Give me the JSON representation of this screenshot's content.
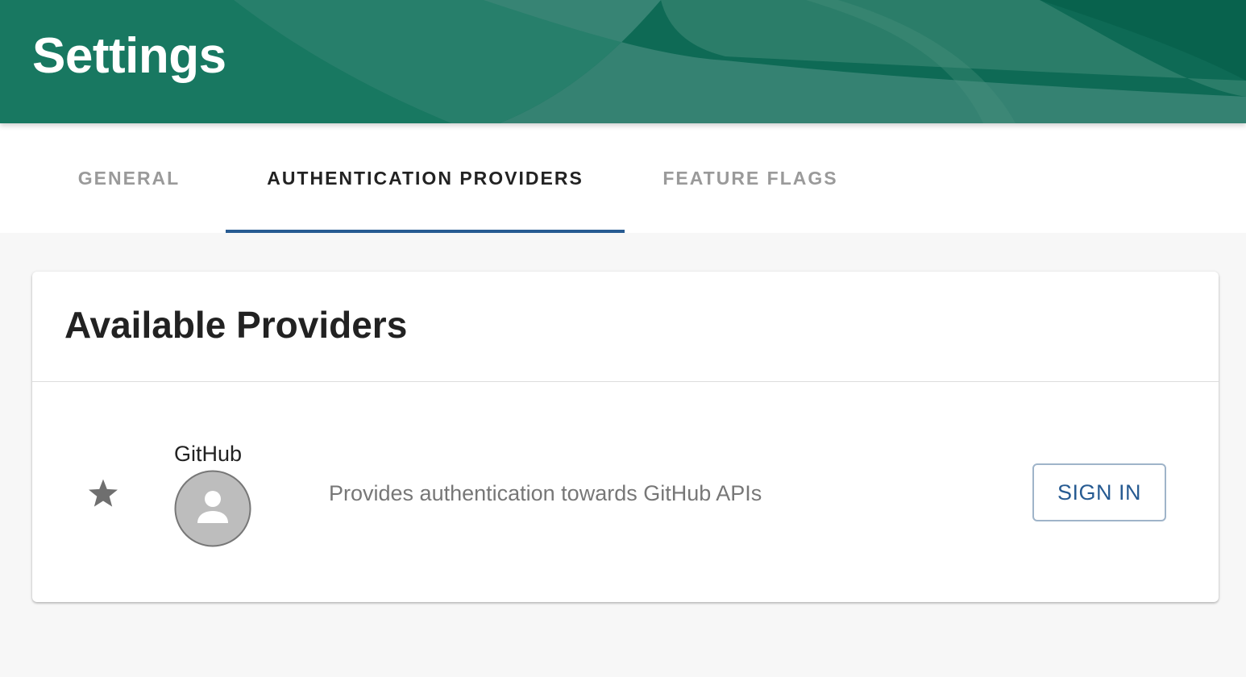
{
  "header": {
    "title": "Settings",
    "background_color": "#0e6a55"
  },
  "tabs": [
    {
      "label": "GENERAL",
      "active": false
    },
    {
      "label": "AUTHENTICATION PROVIDERS",
      "active": true
    },
    {
      "label": "FEATURE FLAGS",
      "active": false
    }
  ],
  "accent_color": "#275b92",
  "card": {
    "title": "Available Providers",
    "providers": [
      {
        "name": "GitHub",
        "description": "Provides authentication towards GitHub APIs",
        "icon": "star-icon",
        "avatar": "user-avatar-icon",
        "button_label": "SIGN IN"
      }
    ]
  }
}
